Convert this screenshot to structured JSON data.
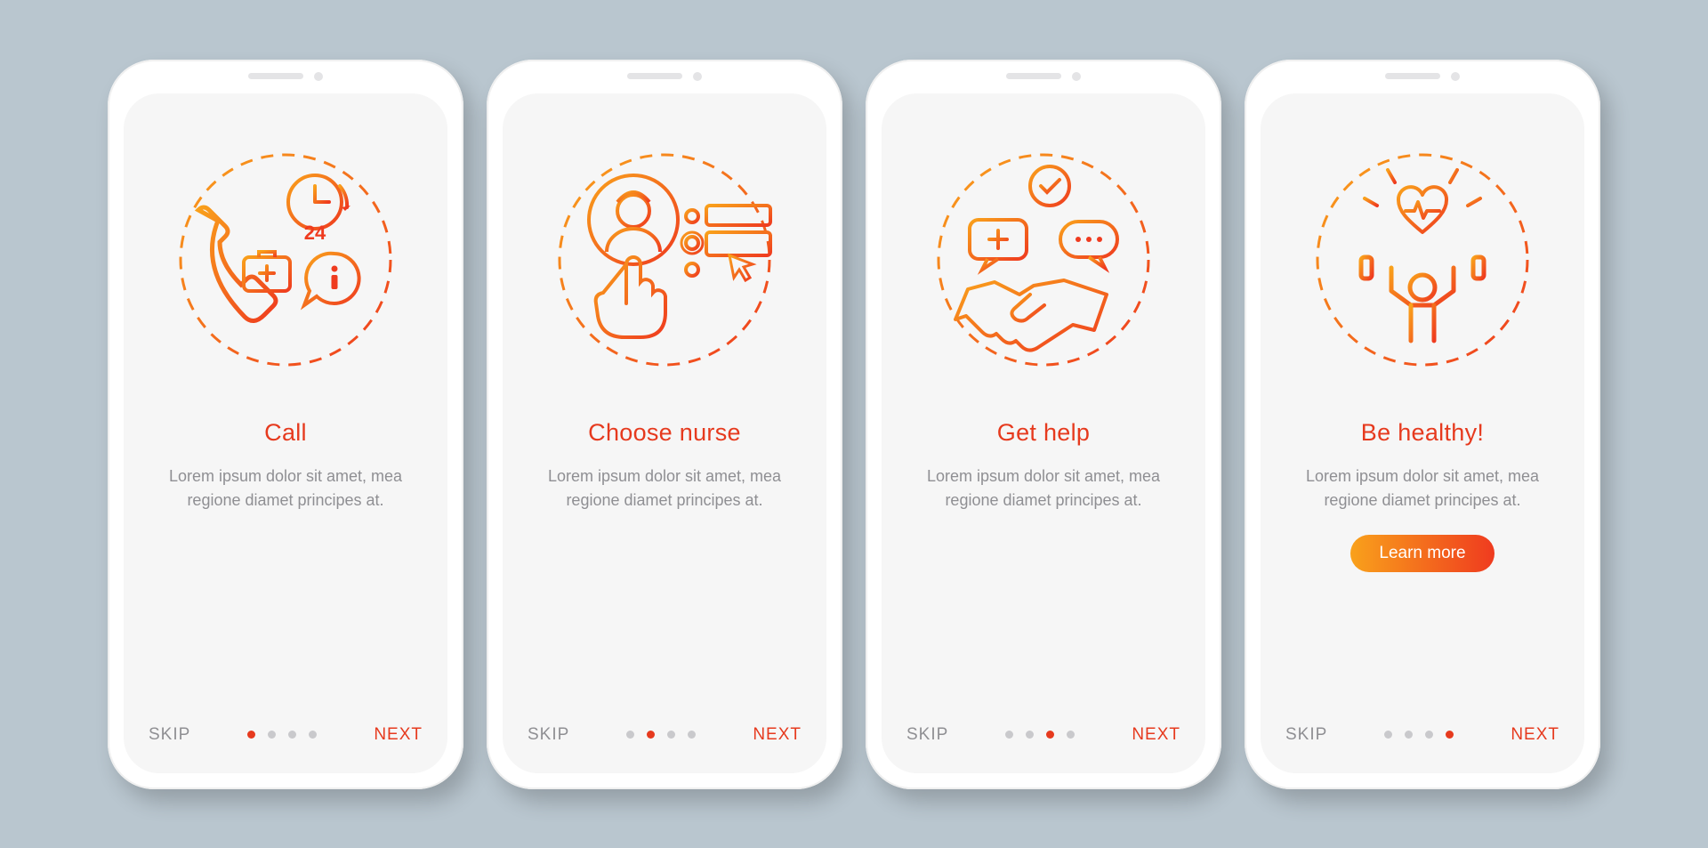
{
  "common": {
    "skip": "SKIP",
    "next": "NEXT",
    "description": "Lorem ipsum dolor sit amet, mea regione diamet principes at.",
    "accent": "#e63a1e",
    "gradient_from": "#f9a11b",
    "gradient_to": "#ef3b1f",
    "total_steps": 4
  },
  "screens": [
    {
      "title": "Call",
      "illustration": "call-icon",
      "active_index": 0,
      "has_cta": false
    },
    {
      "title": "Choose nurse",
      "illustration": "choose-nurse-icon",
      "active_index": 1,
      "has_cta": false
    },
    {
      "title": "Get help",
      "illustration": "get-help-icon",
      "active_index": 2,
      "has_cta": false
    },
    {
      "title": "Be healthy!",
      "illustration": "be-healthy-icon",
      "active_index": 3,
      "has_cta": true,
      "cta_label": "Learn more"
    }
  ]
}
